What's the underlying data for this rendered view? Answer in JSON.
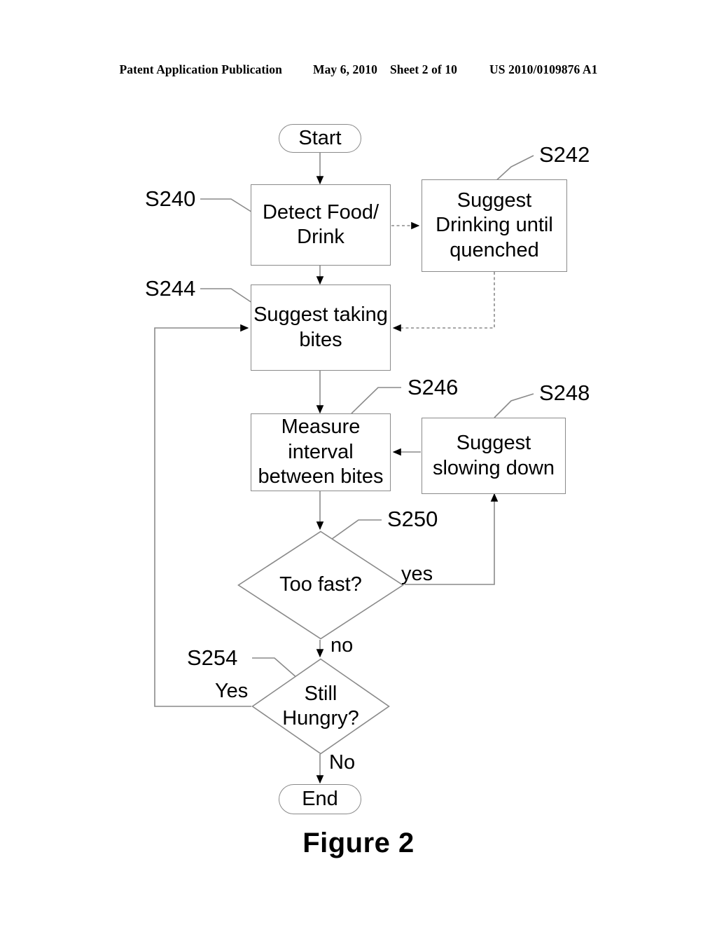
{
  "header": {
    "publication": "Patent Application Publication",
    "date": "May 6, 2010",
    "sheet": "Sheet 2 of 10",
    "number": "US 2010/0109876 A1"
  },
  "figure": {
    "caption": "Figure 2",
    "type": "flowchart",
    "line_color": "#8a8a8a",
    "text_color": "#000000",
    "background": "#ffffff"
  },
  "flowchart": {
    "nodes": [
      {
        "id": "start",
        "shape": "terminal",
        "label": "Start",
        "ref": null
      },
      {
        "id": "s240",
        "shape": "process",
        "label": "Detect Food/\nDrink",
        "ref": "S240"
      },
      {
        "id": "s242",
        "shape": "process",
        "label": "Suggest\nDrinking until\nquenched",
        "ref": "S242"
      },
      {
        "id": "s244",
        "shape": "process",
        "label": "Suggest taking\nbites",
        "ref": "S244"
      },
      {
        "id": "s246",
        "shape": "process",
        "label": "Measure\ninterval\nbetween bites",
        "ref": "S246"
      },
      {
        "id": "s248",
        "shape": "process",
        "label": "Suggest\nslowing down",
        "ref": "S248"
      },
      {
        "id": "s250",
        "shape": "decision",
        "label": "Too fast?",
        "ref": "S250"
      },
      {
        "id": "s254",
        "shape": "decision",
        "label": "Still\nHungry?",
        "ref": "S254"
      },
      {
        "id": "end",
        "shape": "terminal",
        "label": "End",
        "ref": null
      }
    ],
    "node_labels": {
      "start": "Start",
      "s240_line1": "Detect Food/",
      "s240_line2": "Drink",
      "s242_line1": "Suggest",
      "s242_line2": "Drinking until",
      "s242_line3": "quenched",
      "s244_line1": "Suggest taking",
      "s244_line2": "bites",
      "s246_line1": "Measure",
      "s246_line2": "interval",
      "s246_line3": "between bites",
      "s248_line1": "Suggest",
      "s248_line2": "slowing down",
      "s250": "Too fast?",
      "s254_line1": "Still",
      "s254_line2": "Hungry?",
      "end": "End"
    },
    "reference_numerals": {
      "s240": "S240",
      "s242": "S242",
      "s244": "S244",
      "s246": "S246",
      "s248": "S248",
      "s250": "S250",
      "s254": "S254"
    },
    "edge_labels": {
      "too_fast_yes": "yes",
      "too_fast_no": "no",
      "still_hungry_yes": "Yes",
      "still_hungry_no": "No"
    },
    "edges": [
      {
        "from": "start",
        "to": "s240",
        "style": "solid",
        "label": ""
      },
      {
        "from": "s240",
        "to": "s242",
        "style": "dashed",
        "label": ""
      },
      {
        "from": "s240",
        "to": "s244",
        "style": "solid",
        "label": ""
      },
      {
        "from": "s242",
        "to": "s244",
        "style": "dashed",
        "label": ""
      },
      {
        "from": "s244",
        "to": "s246",
        "style": "solid",
        "label": ""
      },
      {
        "from": "s248",
        "to": "s246",
        "style": "solid",
        "label": ""
      },
      {
        "from": "s246",
        "to": "s250",
        "style": "solid",
        "label": ""
      },
      {
        "from": "s250",
        "to": "s248",
        "style": "solid",
        "label": "yes"
      },
      {
        "from": "s250",
        "to": "s254",
        "style": "solid",
        "label": "no"
      },
      {
        "from": "s254",
        "to": "s244",
        "style": "solid",
        "label": "Yes"
      },
      {
        "from": "s254",
        "to": "end",
        "style": "solid",
        "label": "No"
      }
    ]
  }
}
